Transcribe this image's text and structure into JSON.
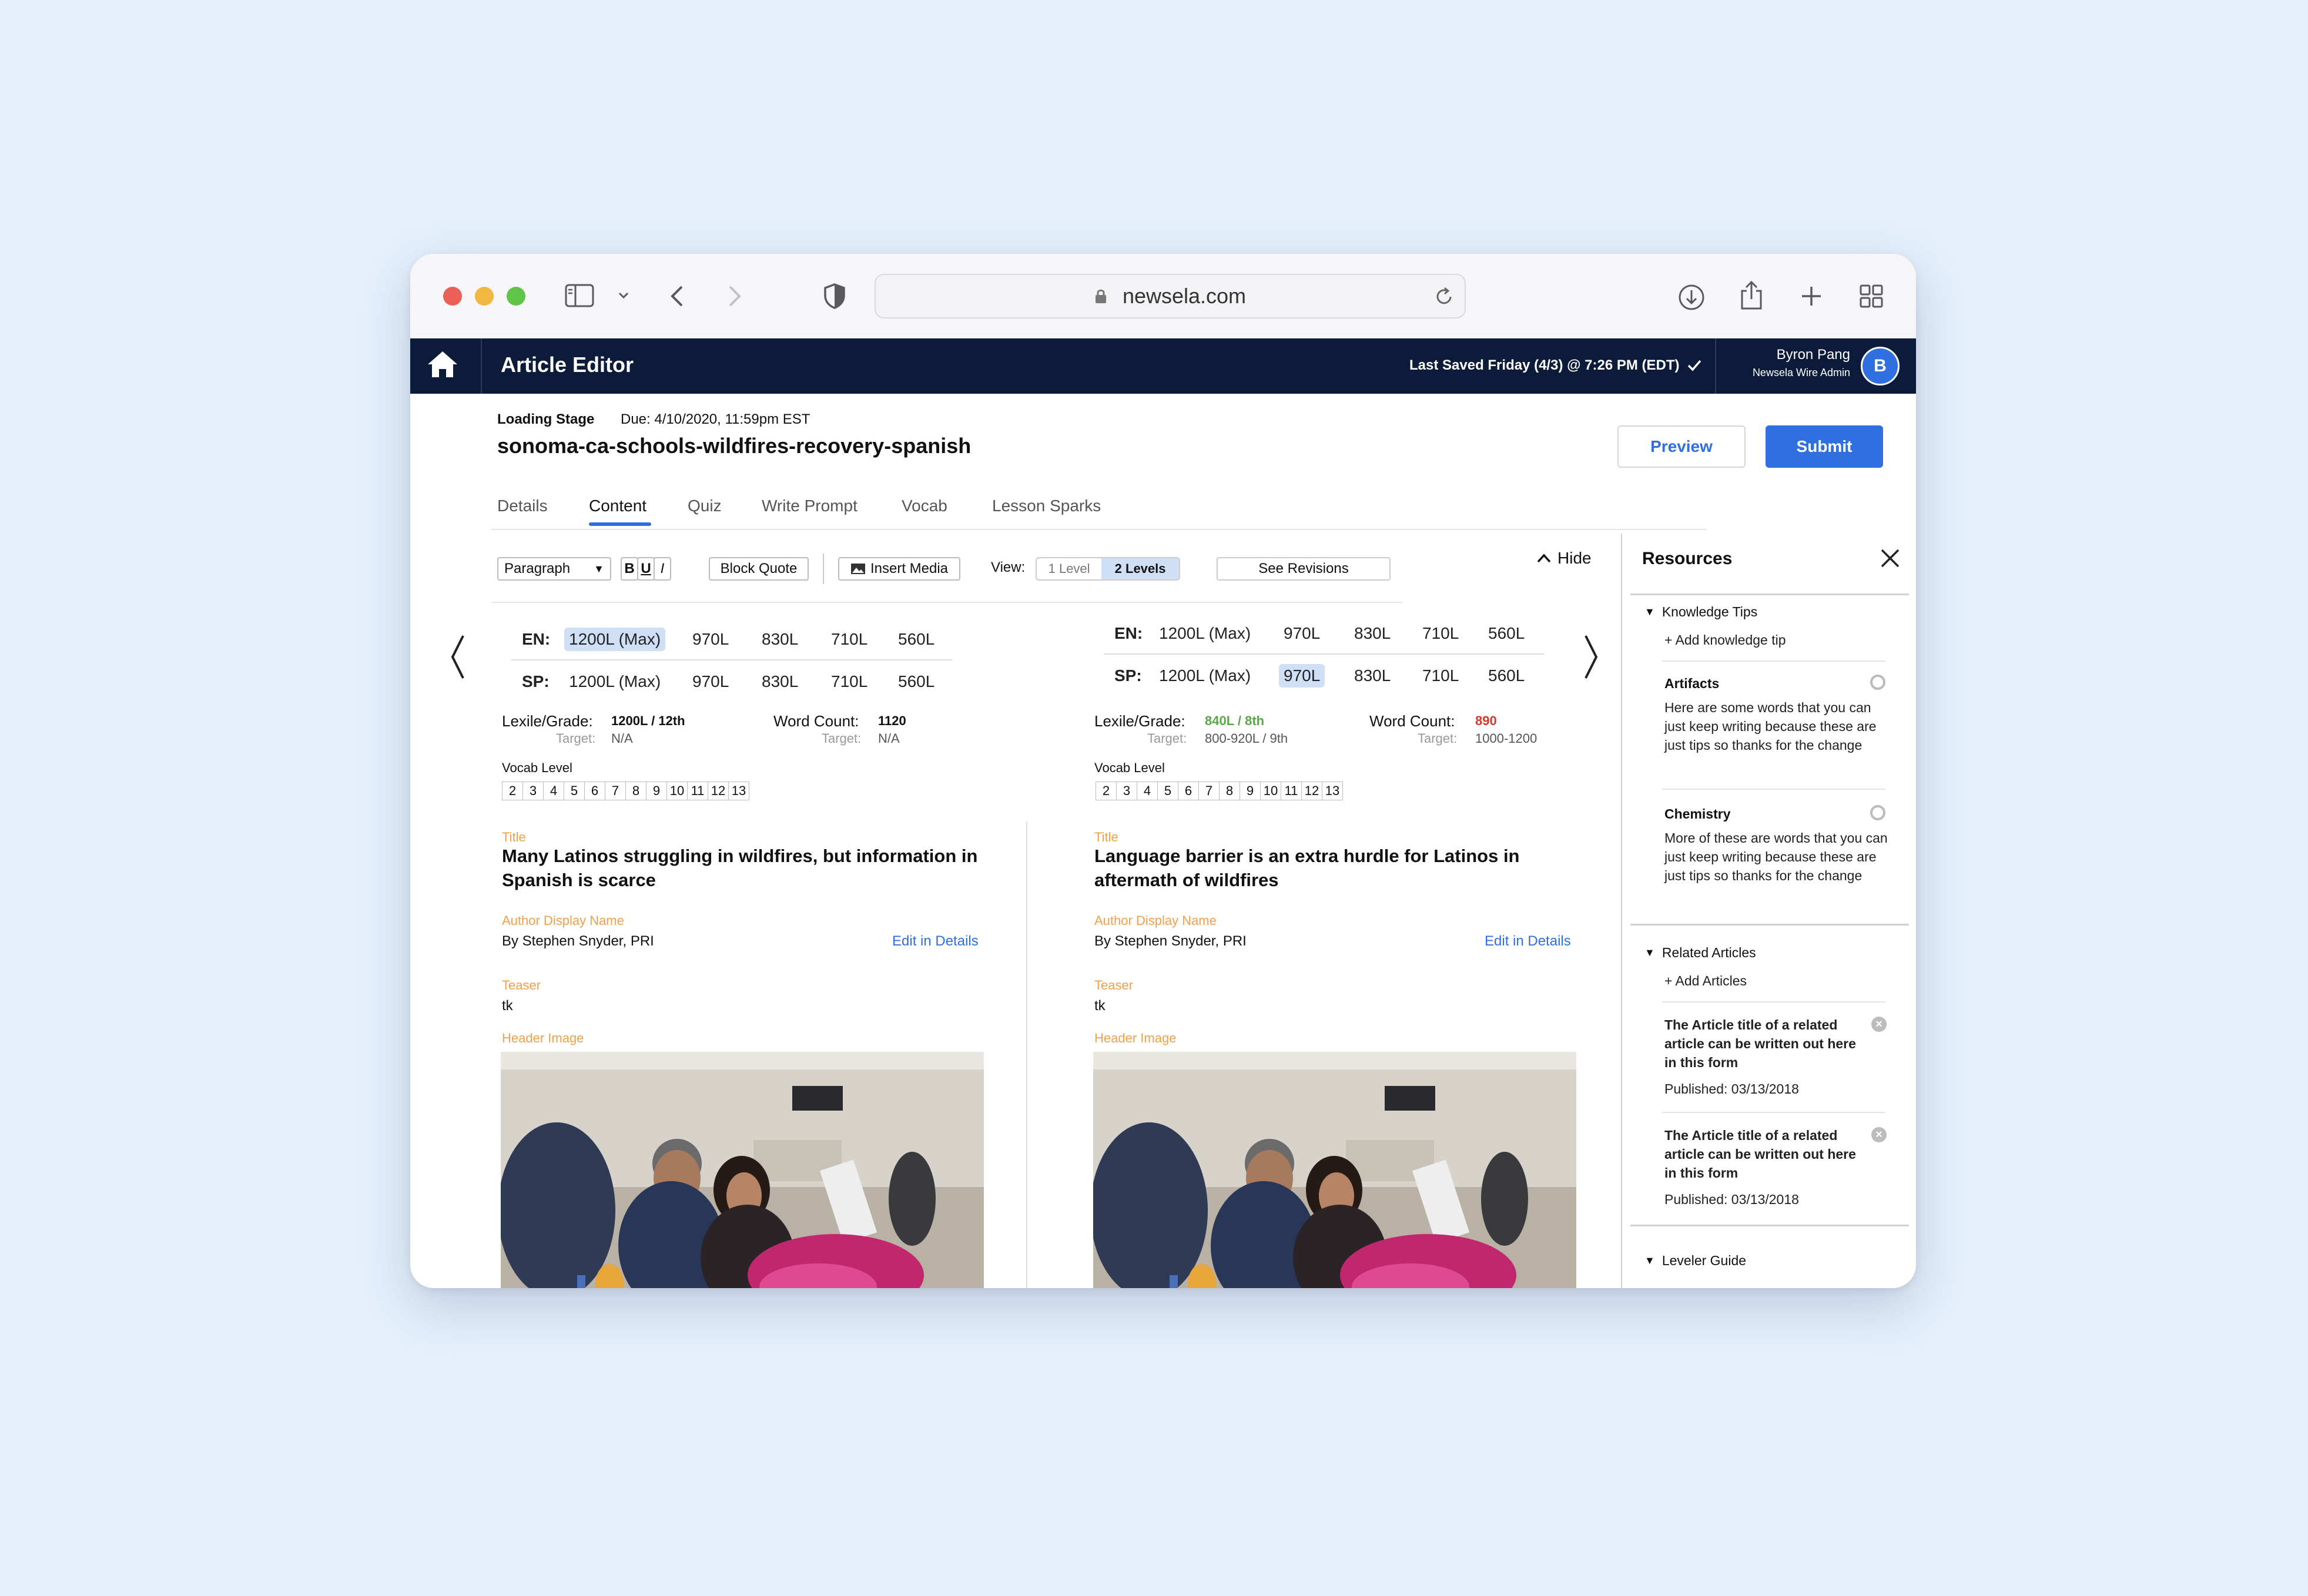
{
  "browser": {
    "url": "newsela.com"
  },
  "app": {
    "title": "Article Editor",
    "last_saved": "Last Saved Friday (4/3) @ 7:26 PM (EDT)",
    "user_name": "Byron Pang",
    "user_role": "Newsela Wire Admin",
    "avatar_initial": "B"
  },
  "article": {
    "stage": "Loading Stage",
    "due": "Due: 4/10/2020, 11:59pm EST",
    "slug": "sonoma-ca-schools-wildfires-recovery-spanish"
  },
  "actions": {
    "preview": "Preview",
    "submit": "Submit"
  },
  "tabs": [
    "Details",
    "Content",
    "Quiz",
    "Write Prompt",
    "Vocab",
    "Lesson Sparks"
  ],
  "active_tab": "Content",
  "toolbar": {
    "paragraph": "Paragraph",
    "bold": "B",
    "underline": "U",
    "italic": "I",
    "block_quote": "Block Quote",
    "insert_media": "Insert Media",
    "view_label": "View:",
    "view_1": "1 Level",
    "view_2": "2 Levels",
    "see_revisions": "See Revisions",
    "hide": "Hide"
  },
  "left": {
    "en_label": "EN:",
    "sp_label": "SP:",
    "en_levels": [
      "1200L (Max)",
      "970L",
      "830L",
      "710L",
      "560L"
    ],
    "sp_levels": [
      "1200L (Max)",
      "970L",
      "830L",
      "710L",
      "560L"
    ],
    "lexile_label": "Lexile/Grade:",
    "lexile_value": "1200L / 12th",
    "target_label": "Target:",
    "lexile_target": "N/A",
    "wc_label": "Word Count:",
    "wc_value": "1120",
    "wc_target": "N/A",
    "vocab_label": "Vocab Level",
    "title_label": "Title",
    "title": "Many Latinos struggling in wildfires, but information in Spanish is scarce",
    "author_label": "Author Display Name",
    "author": "By Stephen Snyder, PRI",
    "edit_link": "Edit in Details",
    "teaser_label": "Teaser",
    "teaser": "tk",
    "header_label": "Header Image"
  },
  "right": {
    "en_label": "EN:",
    "sp_label": "SP:",
    "en_levels": [
      "1200L (Max)",
      "970L",
      "830L",
      "710L",
      "560L"
    ],
    "sp_levels": [
      "1200L (Max)",
      "970L",
      "830L",
      "710L",
      "560L"
    ],
    "lexile_label": "Lexile/Grade:",
    "lexile_value": "840L / 8th",
    "target_label": "Target:",
    "lexile_target": "800-920L / 9th",
    "wc_label": "Word Count:",
    "wc_value": "890",
    "wc_target": "1000-1200",
    "vocab_label": "Vocab Level",
    "title_label": "Title",
    "title": "Language barrier is an extra hurdle for Latinos in aftermath of wildfires",
    "author_label": "Author Display Name",
    "author": "By Stephen Snyder, PRI",
    "edit_link": "Edit in Details",
    "teaser_label": "Teaser",
    "teaser": "tk",
    "header_label": "Header Image"
  },
  "vocab_levels": [
    "2",
    "3",
    "4",
    "5",
    "6",
    "7",
    "8",
    "9",
    "10",
    "11",
    "12",
    "13"
  ],
  "resources": {
    "title": "Resources",
    "knowledge_tips": "Knowledge Tips",
    "add_tip": "+ Add knowledge tip",
    "tip1_title": "Artifacts",
    "tip1_text": "Here are some words that you can just keep writing because these are just tips so thanks for the change",
    "tip2_title": "Chemistry",
    "tip2_text": "More of these are words that you can just keep writing because these are just tips so thanks for the change",
    "related": "Related Articles",
    "add_articles": "+ Add Articles",
    "rel1_title": "The Article title of a related article can be written out here in this form",
    "rel1_pub": "Published: 03/13/2018",
    "rel2_title": "The Article title of a related article can be written out here in this form",
    "rel2_pub": "Published: 03/13/2018",
    "leveler": "Leveler Guide"
  },
  "colors": {
    "navy": "#0c1b3a",
    "blue": "#2f6fe0",
    "orange": "#f0a04b",
    "green": "#5aa845",
    "red": "#d9362b",
    "selected_bg": "#cfe0f6"
  }
}
